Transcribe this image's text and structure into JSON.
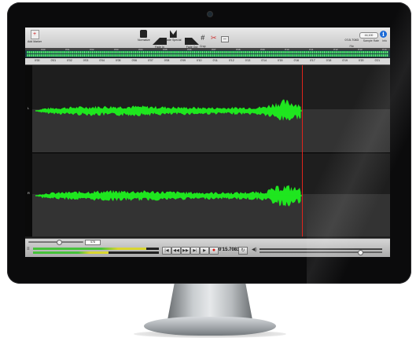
{
  "toolbar": {
    "add_marker_label": "Add Marker",
    "add_marker_glyph": "+",
    "buttons": [
      {
        "icon": "lock-icon",
        "label": "Normalize"
      },
      {
        "icon": "fade-in-icon",
        "label": "Fade In"
      },
      {
        "icon": "fade-special-icon",
        "label": "Fade Special"
      },
      {
        "icon": "fade-out-icon",
        "label": "Fade Out"
      },
      {
        "icon": "crop-icon",
        "label": "Crop",
        "glyph": "#"
      },
      {
        "icon": "scissors-icon",
        "label": "",
        "glyph": "✂"
      },
      {
        "icon": "split-icon",
        "label": "",
        "glyph": "⇔"
      }
    ],
    "time_value": "0'15.7083",
    "time_unit": "File",
    "time_label": "Duration",
    "sample_rate_value": "44,100",
    "sample_rate_label": "Sample Rate",
    "info_glyph": "i",
    "info_label": "Info"
  },
  "ruler": {
    "ticks": [
      "0'00",
      "0'01",
      "0'02",
      "0'03",
      "0'04",
      "0'05",
      "0'06",
      "0'07",
      "0'08",
      "0'09",
      "0'10",
      "0'11",
      "0'12",
      "0'13",
      "0'14",
      "0'15",
      "0'16",
      "0'17",
      "0'18",
      "0'19",
      "0'20",
      "0'21"
    ]
  },
  "overview": {
    "ticks": [
      "0'00",
      "0'01",
      "0'02",
      "0'03",
      "0'04",
      "0'05",
      "0'06",
      "0'07",
      "0'08",
      "0'09",
      "0'10",
      "0'11",
      "0'12",
      "0'13",
      "0'14"
    ]
  },
  "tracks": {
    "marks": [
      "L",
      "R"
    ],
    "wave_color": "#1fe61f",
    "duration_fraction": 0.76
  },
  "transport": {
    "zoom_value": "578",
    "time_readout": "0'15.7083",
    "level_top": 0.9,
    "level_bottom": 0.6,
    "buttons": [
      {
        "name": "go-to-start-button",
        "glyph": "|◀"
      },
      {
        "name": "rewind-button",
        "glyph": "◀◀"
      },
      {
        "name": "fast-forward-button",
        "glyph": "▶▶"
      },
      {
        "name": "go-to-end-button",
        "glyph": "▶|"
      },
      {
        "name": "play-button",
        "glyph": "▶"
      },
      {
        "name": "record-button",
        "glyph": "●"
      }
    ],
    "loop_glyph": "↻",
    "left_glyph": "≡",
    "right_glyph": "◀)"
  },
  "colors": {
    "cursor": "#e0241c",
    "waveform": "#1fe61f",
    "info": "#1b6ad6"
  }
}
